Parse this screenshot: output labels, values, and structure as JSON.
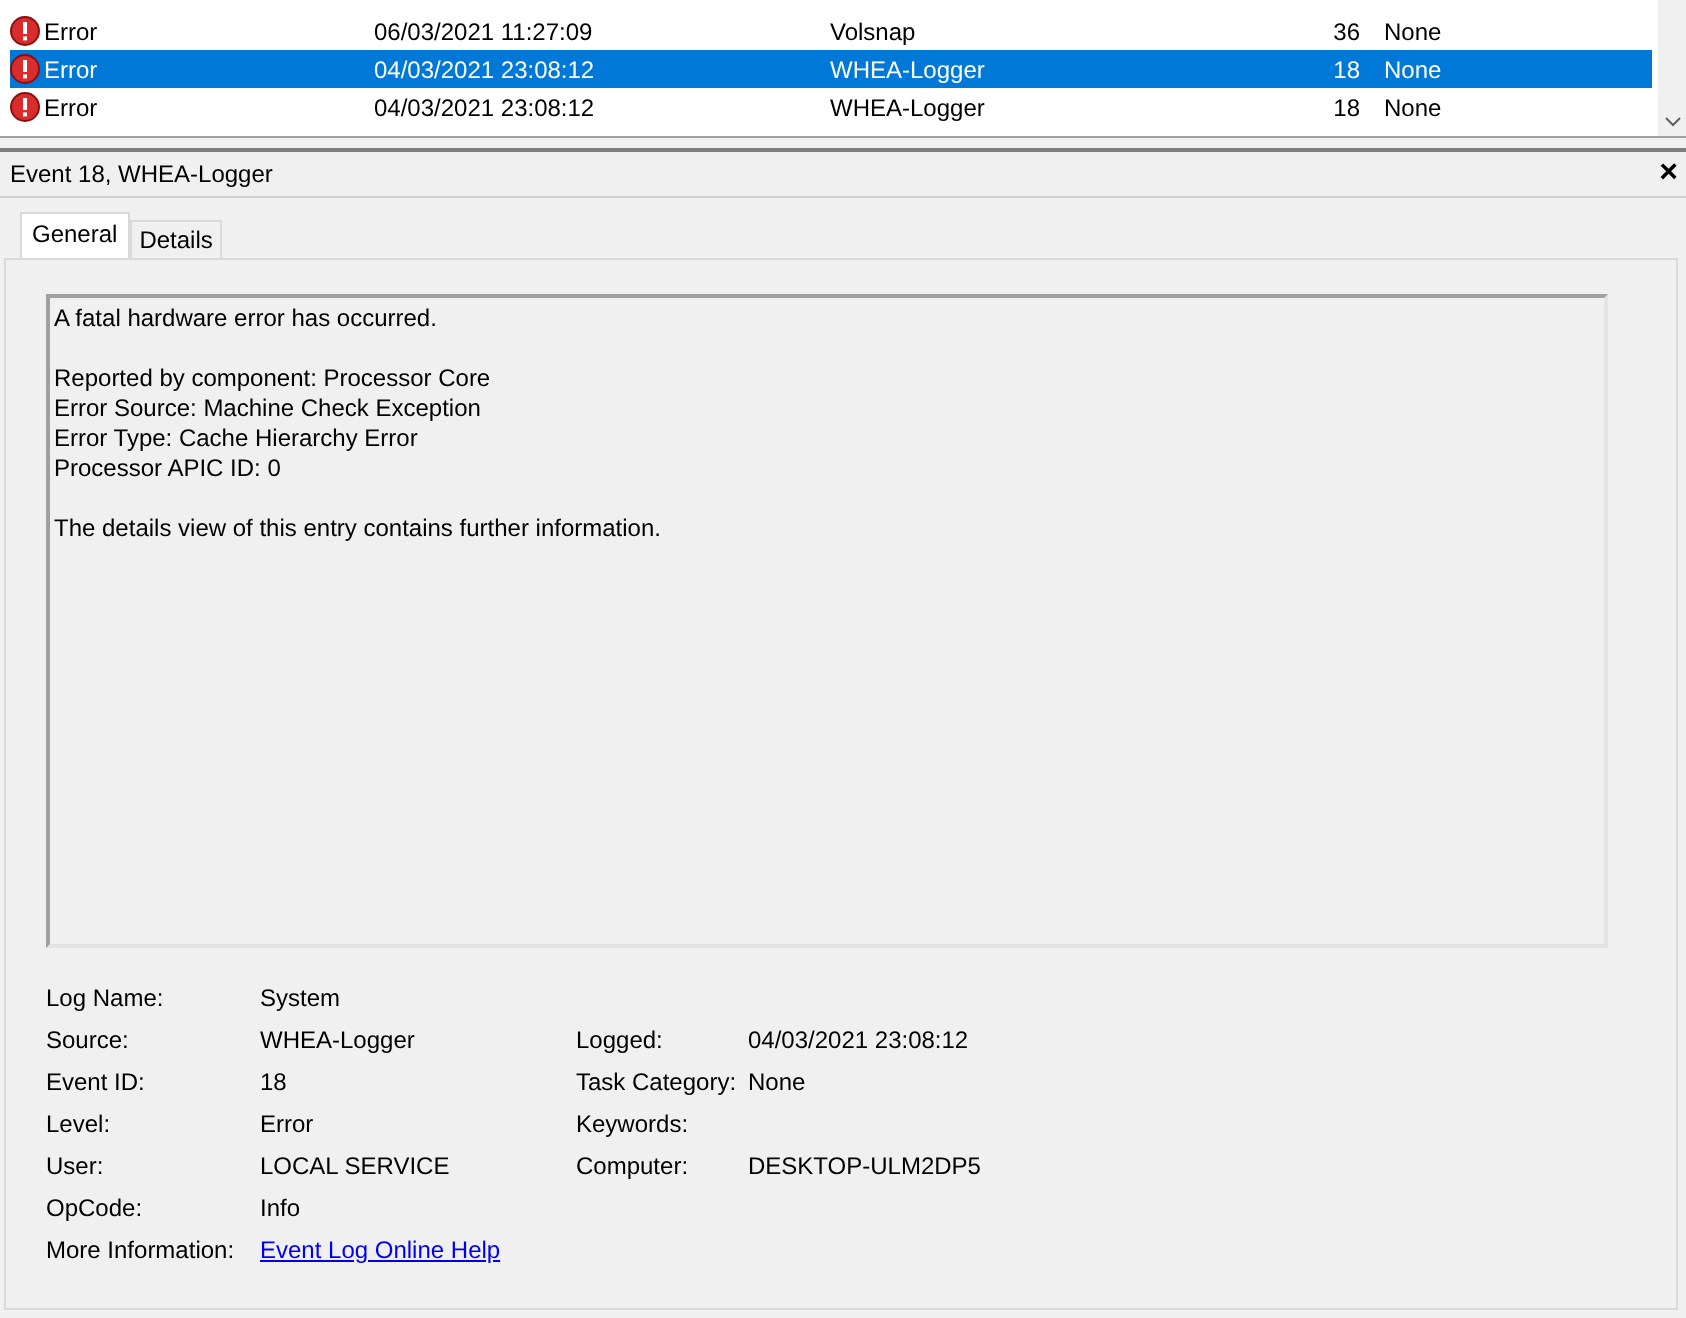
{
  "events": [
    {
      "kind": "error",
      "level": "Error",
      "date": "06/03/2021 11:27:09",
      "source": "Volsnap",
      "event_id": "36",
      "task_category": "None",
      "selected": false
    },
    {
      "kind": "error",
      "level": "Error",
      "date": "04/03/2021 23:08:12",
      "source": "WHEA-Logger",
      "event_id": "18",
      "task_category": "None",
      "selected": true
    },
    {
      "kind": "error",
      "level": "Error",
      "date": "04/03/2021 23:08:12",
      "source": "WHEA-Logger",
      "event_id": "18",
      "task_category": "None",
      "selected": false
    }
  ],
  "details": {
    "title": "Event 18, WHEA-Logger",
    "close": "×",
    "tabs": [
      {
        "label": "General",
        "selected": true
      },
      {
        "label": "Details",
        "selected": false
      }
    ],
    "message": [
      [
        "A fatal hardware error has occurred."
      ],
      [
        "Reported by component: Processor Core",
        "Error Source: Machine Check Exception",
        "Error Type: Cache Hierarchy Error",
        "Processor APIC ID: 0"
      ],
      [
        "The details view of this entry contains further information."
      ]
    ],
    "fields_left": [
      {
        "label": "Log Name:",
        "value": "System"
      },
      {
        "label": "Source:",
        "value": "WHEA-Logger"
      },
      {
        "label": "Event ID:",
        "value": "18"
      },
      {
        "label": "Level:",
        "value": "Error"
      },
      {
        "label": "User:",
        "value": "LOCAL SERVICE"
      },
      {
        "label": "OpCode:",
        "value": "Info"
      }
    ],
    "fields_right": [
      {
        "label": "Logged:",
        "value": "04/03/2021 23:08:12"
      },
      {
        "label": "Task Category:",
        "value": "None"
      },
      {
        "label": "Keywords:"
      },
      {
        "label": "Computer:",
        "value": "DESKTOP-ULM2DP5"
      }
    ],
    "more_info": {
      "label": "More Information:",
      "link": "Event Log Online Help"
    }
  }
}
